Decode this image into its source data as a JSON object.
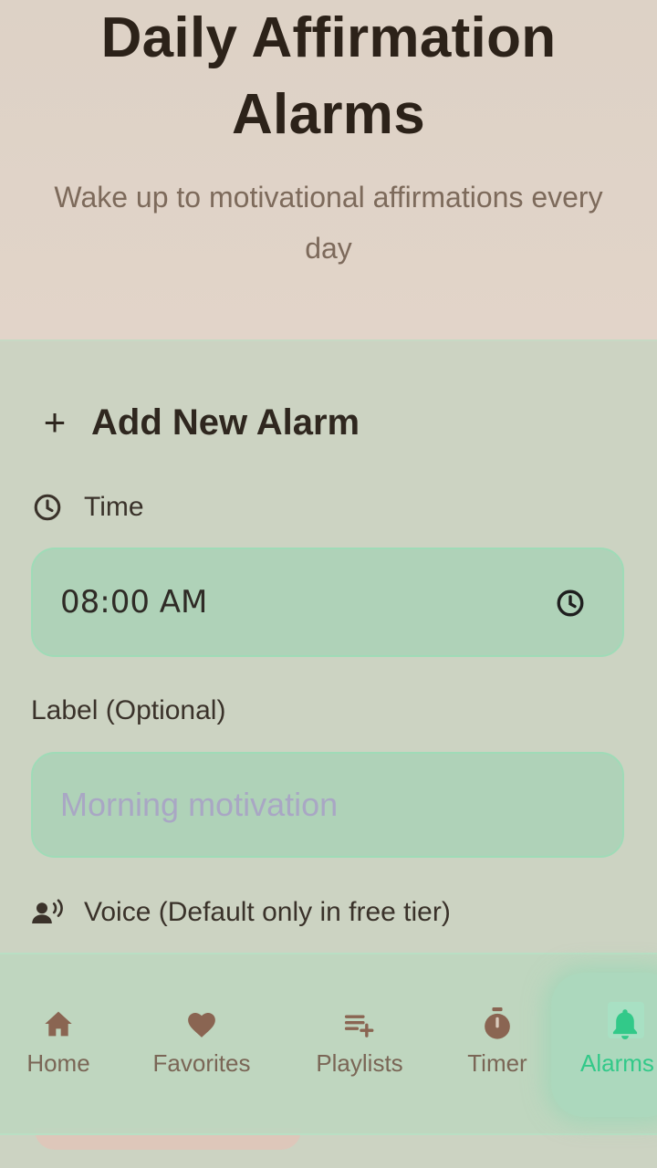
{
  "header": {
    "title_line1": "Daily Affirmation",
    "title_line2": "Alarms",
    "subtitle_line1": "Wake up to motivational affirmations every",
    "subtitle_line2": "day"
  },
  "form": {
    "section_title": "Add New Alarm",
    "time_label": "Time",
    "time_value": "08:00 AM",
    "label_field_label": "Label (Optional)",
    "label_placeholder": "Morning motivation",
    "voice_label": "Voice (Default only in free tier)"
  },
  "nav": {
    "items": [
      {
        "label": "Home",
        "icon": "home-icon"
      },
      {
        "label": "Favorites",
        "icon": "heart-icon"
      },
      {
        "label": "Playlists",
        "icon": "playlist-add-icon"
      },
      {
        "label": "Timer",
        "icon": "timer-icon"
      },
      {
        "label": "Alarms",
        "icon": "bell-icon",
        "active": true
      }
    ]
  },
  "colors": {
    "accent": "#32c989",
    "card_bg": "#ccd3c2",
    "input_bg": "#afd2b8",
    "header_bg": "#dfd3c8"
  }
}
